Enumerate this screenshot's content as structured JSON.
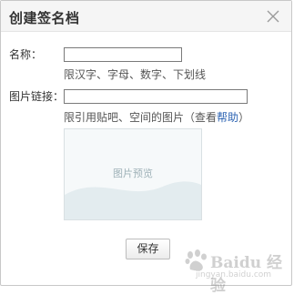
{
  "dialog": {
    "title": "创建签名档",
    "close_icon": "close-icon"
  },
  "form": {
    "name_label": "名称：",
    "name_value": "",
    "name_hint": "限汉字、字母、数字、下划线",
    "image_link_label": "图片链接：",
    "image_link_value": "",
    "image_link_hint": "限引用贴吧、空间的图片（查看",
    "help_link": "帮助",
    "image_link_hint_end": "）",
    "preview_text": "图片预览",
    "save_label": "保存"
  },
  "watermark": {
    "brand": "Baidu 经验",
    "url": "jingyan.baidu.com",
    "brand_icon": "baidu-paw-icon"
  },
  "colors": {
    "title_bg": "#f5f5f5",
    "link": "#2d64b3",
    "preview_bg": "#f6f9fa",
    "preview_wave": "#e3ecef"
  }
}
